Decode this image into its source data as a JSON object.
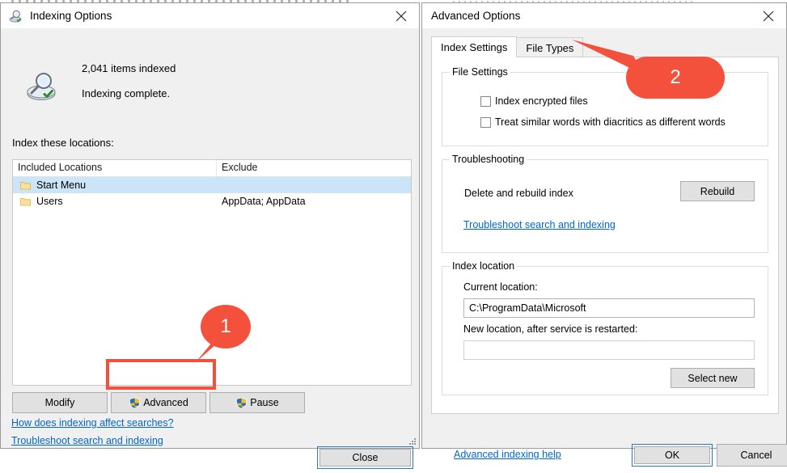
{
  "colors": {
    "callout_red": "#f4513c",
    "link_blue": "#0066cc",
    "selection_blue": "#cce4f7",
    "focus_blue": "#2a7ac0",
    "button_face": "#e1e1e1",
    "dialog_face": "#f0f0f0"
  },
  "indexing_options": {
    "title": "Indexing Options",
    "app_icon": "indexing-options-icon",
    "close_icon": "close-icon",
    "status": {
      "icon": "indexing-status-icon",
      "count": "2,041 items indexed",
      "state": "Indexing complete."
    },
    "locations_label": "Index these locations:",
    "list": {
      "columns": [
        "Included Locations",
        "Exclude"
      ],
      "rows": [
        {
          "icon": "folder-icon",
          "included": "Start Menu",
          "exclude": "",
          "selected": true
        },
        {
          "icon": "folder-icon",
          "included": "Users",
          "exclude": "AppData; AppData",
          "selected": false
        }
      ]
    },
    "buttons": {
      "modify": "Modify",
      "advanced": "Advanced",
      "pause": "Pause",
      "close": "Close"
    },
    "links": {
      "affect_searches": "How does indexing affect searches?",
      "troubleshoot": "Troubleshoot search and indexing"
    }
  },
  "advanced_options": {
    "title": "Advanced Options",
    "close_icon": "close-icon",
    "tabs": [
      {
        "label": "Index Settings",
        "active": true
      },
      {
        "label": "File Types",
        "active": false
      }
    ],
    "file_settings": {
      "legend": "File Settings",
      "checkboxes": [
        {
          "label": "Index encrypted files",
          "checked": false
        },
        {
          "label": "Treat similar words with diacritics as different words",
          "checked": false
        }
      ]
    },
    "troubleshooting": {
      "legend": "Troubleshooting",
      "text": "Delete and rebuild index",
      "rebuild_button": "Rebuild",
      "link": "Troubleshoot search and indexing"
    },
    "index_location": {
      "legend": "Index location",
      "current_label": "Current location:",
      "current_value": "C:\\ProgramData\\Microsoft",
      "new_label": "New location, after service is restarted:",
      "new_value": "",
      "new_placeholder": "",
      "select_new_button": "Select new"
    },
    "help_link": "Advanced indexing help",
    "footer": {
      "ok": "OK",
      "cancel": "Cancel"
    }
  },
  "callouts": [
    {
      "number": "1",
      "points_at": "advanced-button"
    },
    {
      "number": "2",
      "points_at": "file-types-tab"
    }
  ]
}
